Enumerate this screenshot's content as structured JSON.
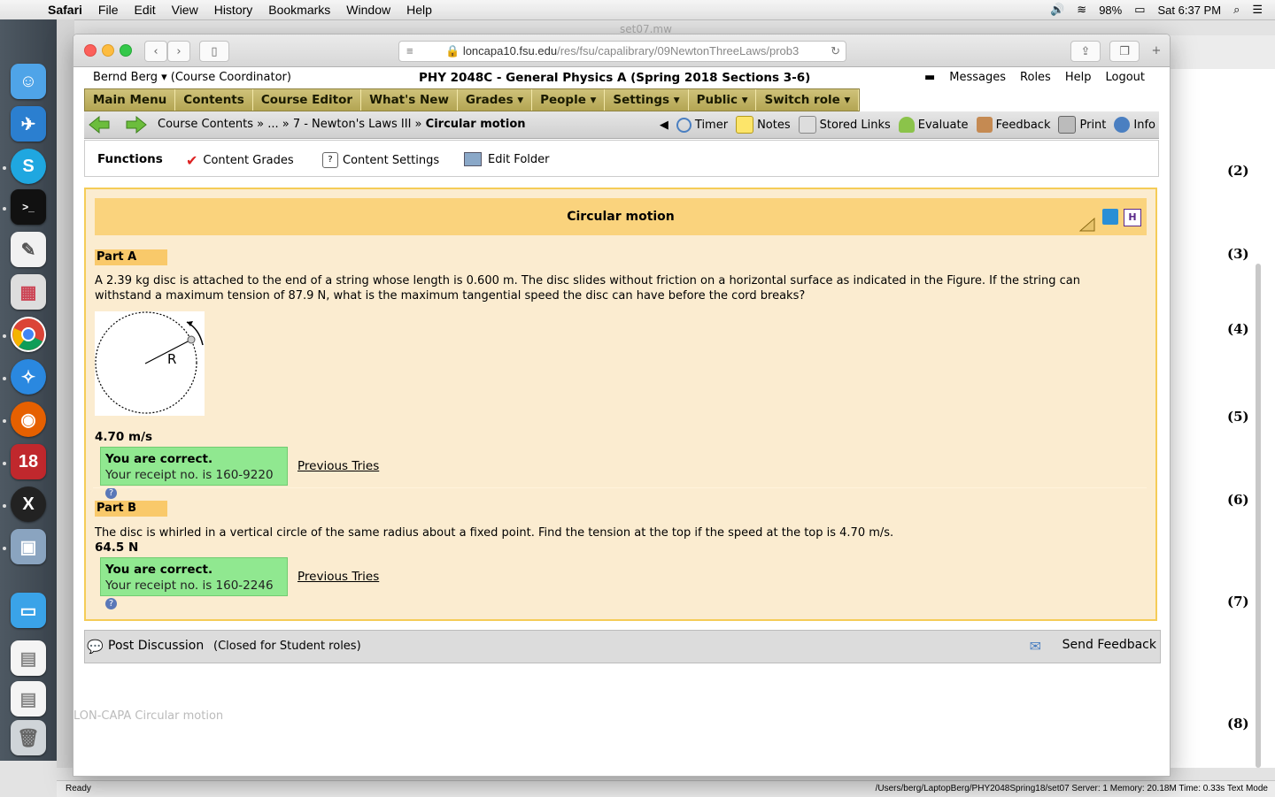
{
  "menubar": {
    "app": "Safari",
    "items": [
      "File",
      "Edit",
      "View",
      "History",
      "Bookmarks",
      "Window",
      "Help"
    ],
    "battery": "98%",
    "clock": "Sat 6:37 PM"
  },
  "background": {
    "window_title": "set07.mw",
    "equation_numbers": [
      "(2)",
      "(3)",
      "(4)",
      "(5)",
      "(6)",
      "(7)",
      "(8)"
    ],
    "status_left": "Ready",
    "status_right": "/Users/berg/LaptopBerg/PHY2048Spring18/set07   Server: 1   Memory: 20.18M   Time: 0.33s   Text Mode",
    "ghost_label": "LON-CAPA Circular motion"
  },
  "browser": {
    "url_host": "loncapa10.fsu.edu",
    "url_path": "/res/fsu/capalibrary/09NewtonThreeLaws/prob3"
  },
  "header": {
    "user": "Bernd Berg ▾",
    "role": "(Course Coordinator)",
    "course_title": "PHY 2048C - General Physics A (Spring 2018 Sections 3-6)",
    "links": [
      "Messages",
      "Roles",
      "Help",
      "Logout"
    ]
  },
  "main_menu": [
    "Main Menu",
    "Contents",
    "Course Editor",
    "What's New",
    "Grades ▾",
    "People ▾",
    "Settings ▾",
    "Public ▾",
    "Switch role ▾"
  ],
  "breadcrumb": {
    "trail": "Course Contents » ... » 7 - Newton's Laws III »",
    "current": "Circular motion"
  },
  "nav_tools": [
    "Timer",
    "Notes",
    "Stored Links",
    "Evaluate",
    "Feedback",
    "Print",
    "Info"
  ],
  "functions": {
    "title": "Functions",
    "items": [
      "Content Grades",
      "Content Settings",
      "Edit Folder"
    ]
  },
  "problem": {
    "title": "Circular motion",
    "part_a": {
      "label": "Part A",
      "text": "A 2.39 kg disc is attached to the end of a string whose length is 0.600 m. The disc slides without friction on a horizontal surface as indicated in the Figure. If the string can withstand a maximum tension of 87.9 N, what is the maximum tangential speed the disc can have before the cord breaks?",
      "figure_label": "R",
      "answer": "4.70 m/s",
      "correct": "You are correct.",
      "receipt": "Your receipt no. is 160-9220",
      "previous_tries": "Previous Tries"
    },
    "part_b": {
      "label": "Part B",
      "text": "The disc is whirled in a vertical circle of the same radius about a fixed point. Find the tension at the top if the speed at the top is 4.70 m/s.",
      "answer": "64.5 N",
      "correct": "You are correct.",
      "receipt": "Your receipt no. is 160-2246",
      "previous_tries": "Previous Tries"
    }
  },
  "discussion": {
    "post": "Post Discussion",
    "note": "(Closed for Student roles)",
    "send_feedback": "Send Feedback"
  }
}
